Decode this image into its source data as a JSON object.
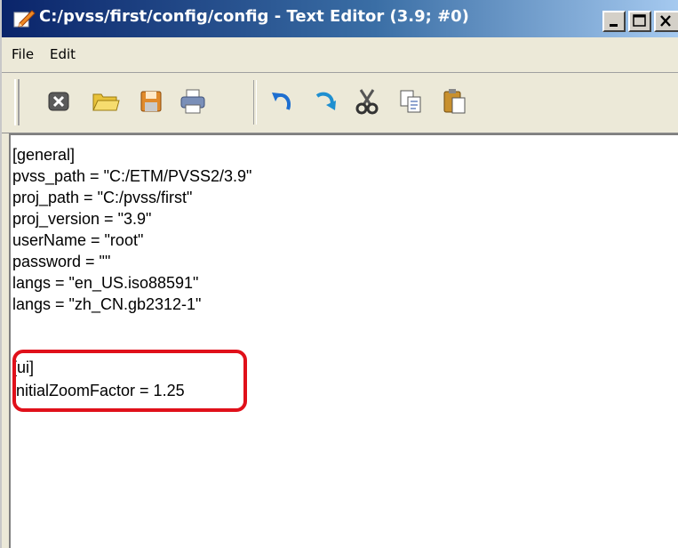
{
  "window": {
    "title": "C:/pvss/first/config/config - Text Editor (3.9; #0)",
    "minimize_icon": "minimize-icon",
    "maximize_icon": "maximize-icon",
    "close_icon": "close-icon"
  },
  "menu": {
    "items": [
      {
        "label": "File"
      },
      {
        "label": "Edit"
      }
    ]
  },
  "toolbar": {
    "buttons": [
      {
        "icon": "close-file-icon"
      },
      {
        "icon": "open-folder-icon"
      },
      {
        "icon": "save-icon"
      },
      {
        "icon": "print-icon"
      },
      {
        "icon": "undo-icon"
      },
      {
        "icon": "redo-icon"
      },
      {
        "icon": "cut-icon"
      },
      {
        "icon": "copy-icon"
      },
      {
        "icon": "paste-icon"
      }
    ]
  },
  "editor": {
    "lines": [
      "[general]",
      "pvss_path = \"C:/ETM/PVSS2/3.9\"",
      "proj_path = \"C:/pvss/first\"",
      "proj_version = \"3.9\"",
      "userName = \"root\"",
      "password = \"\"",
      "langs = \"en_US.iso88591\"",
      "langs = \"zh_CN.gb2312-1\"",
      "",
      "[ui]",
      "initialZoomFactor = 1.25"
    ],
    "highlight_color": "#e0101a"
  },
  "colors": {
    "titlebar_start": "#0a246a",
    "titlebar_end": "#a6caf0",
    "chrome": "#ece9d8"
  }
}
